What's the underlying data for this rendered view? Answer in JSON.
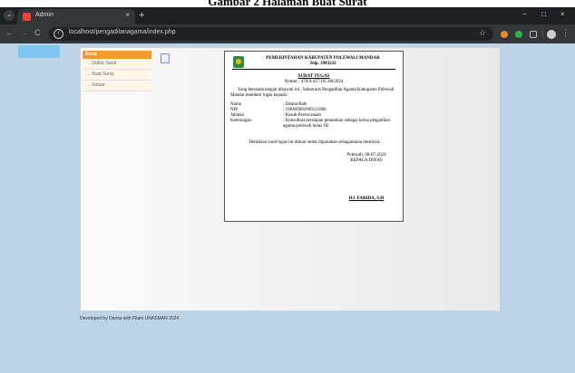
{
  "caption": "Gambar 2 Halaman Buat Surat",
  "browser": {
    "tab_title": "Admin",
    "tab_close": "×",
    "new_tab": "+",
    "url": "localhost/pengadilanagama/index.php",
    "controls": {
      "back": "←",
      "forward": "→",
      "reload": "C",
      "minimize": "−",
      "maximize": "□",
      "close": "×",
      "star": "☆",
      "menu": "⋮",
      "tab_list": "⌄"
    }
  },
  "sidebar": {
    "title": "Surat",
    "items": [
      "→ Daftar Surat",
      "→ Buat Surat",
      "→ Keluar"
    ]
  },
  "letter": {
    "header_line1": "PEMERINTAHAN KABUPATEN POLEWALI MANDAR",
    "header_line2": "Telp. 3903232",
    "title": "SURAT TUGAS",
    "nomor": "Nomor : 470/9/437.105.08/2024",
    "intro": "Yang bertanda tangan dibawah ini , Sekretaris Pengadilan Agama Kabupaten Polewali Mandar memberi tugas kepada :",
    "fields": [
      {
        "label": "Nama",
        "value": ": Damia Rahi"
      },
      {
        "label": "NIP",
        "value": ": 198409092009121006"
      },
      {
        "label": "Jabatan",
        "value": ": Kasub Perencanaan"
      },
      {
        "label": "Keterangan",
        "value": ": Konsultasi persiapan pelantikan sebagai ketua pengadilan agama polewali kelas 1B"
      }
    ],
    "closing": "Demikian surat tugas ini dibuat untuk digunakan sebagaimana mestinya.",
    "place_date": "Polewali, 08-07-2024",
    "signer_title": "KEPALA DINAS",
    "signer_name": "HJ. FARIDA, S.H"
  },
  "footer": "Developed by Damia with Filam UNASMAN 2024",
  "colors": {
    "menu_header": "#f29a2e",
    "page_bg": "#bcd4e6",
    "logo_box": "#7ec7f2",
    "browser_dark": "#35363a"
  }
}
